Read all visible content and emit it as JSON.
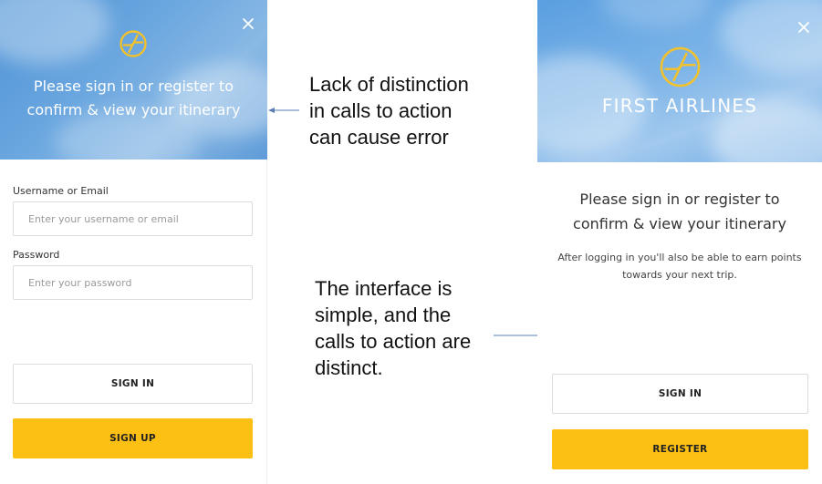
{
  "left_panel": {
    "hero_text_line1": "Please sign in or register to",
    "hero_text_line2": "confirm & view your itinerary",
    "username_label": "Username or Email",
    "username_placeholder": "Enter your username or email",
    "password_label": "Password",
    "password_placeholder": "Enter your password",
    "sign_in_label": "SIGN IN",
    "sign_up_label": "SIGN UP"
  },
  "annotations": {
    "top_line1": "Lack of distinction",
    "top_line2": "in calls to action",
    "top_line3": "can cause error",
    "bottom_line1": "The interface is",
    "bottom_line2": "simple, and the",
    "bottom_line3": "calls to action are",
    "bottom_line4": "distinct."
  },
  "right_panel": {
    "brand_name": "FIRST AIRLINES",
    "heading_line1": "Please sign in or register to",
    "heading_line2": "confirm & view your itinerary",
    "sub_line1": "After logging in you'll also be able to earn points",
    "sub_line2": "towards your next trip.",
    "sign_in_label": "SIGN IN",
    "register_label": "REGISTER"
  },
  "icons": {
    "logo": "airline-logo-icon",
    "close": "close-icon"
  },
  "colors": {
    "accent_yellow": "#fcbf14",
    "logo_yellow": "#f2c12e",
    "sky_blue": "#5e9bd8"
  }
}
